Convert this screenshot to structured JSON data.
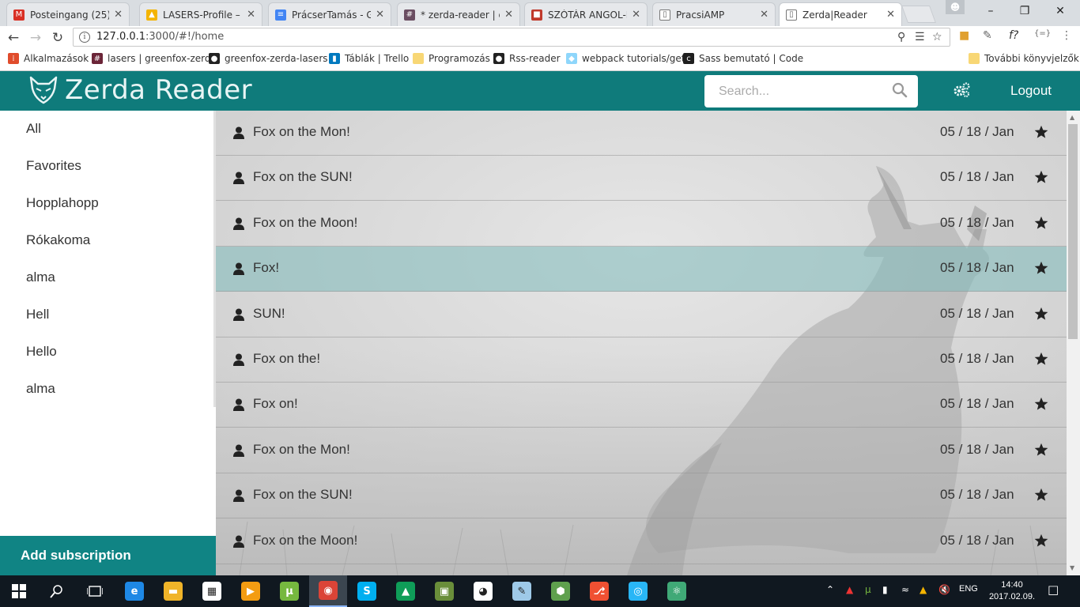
{
  "browser": {
    "tabs": [
      {
        "title": "Posteingang (25) -",
        "icon": "gmail-icon",
        "color": "#d93025",
        "glyph": "M"
      },
      {
        "title": "LASERS-Profile – G",
        "icon": "google-drive-icon",
        "color": "#f4b400",
        "glyph": "▲"
      },
      {
        "title": "PrácserTamás - Go",
        "icon": "google-docs-icon",
        "color": "#4285f4",
        "glyph": "≡"
      },
      {
        "title": "* zerda-reader | gr",
        "icon": "slack-hash-icon",
        "color": "#6b4e62",
        "glyph": "#"
      },
      {
        "title": "SZÓTÁR ANGOL-M",
        "icon": "flag-icon",
        "color": "#c0392b",
        "glyph": "■"
      },
      {
        "title": "PracsiAMP",
        "icon": "page-icon",
        "color": "#ffffff",
        "glyph": "▯"
      },
      {
        "title": "Zerda|Reader",
        "icon": "page-icon",
        "color": "#ffffff",
        "glyph": "▯"
      }
    ],
    "url_host": "127.0.0.1",
    "url_path": ":3000/#!/home",
    "bookmarks": [
      {
        "label": "Alkalmazások",
        "icon": "apps-icon",
        "color": "#e04c2c",
        "glyph": "⁞"
      },
      {
        "label": "lasers | greenfox-zerd",
        "icon": "slack-icon",
        "color": "#6b2538",
        "glyph": "#"
      },
      {
        "label": "greenfox-zerda-lasers",
        "icon": "github-icon",
        "color": "#222222",
        "glyph": "●"
      },
      {
        "label": "Táblák | Trello",
        "icon": "trello-icon",
        "color": "#0079bf",
        "glyph": "▮"
      },
      {
        "label": "Programozás",
        "icon": "folder-icon",
        "color": "#f8d775",
        "glyph": ""
      },
      {
        "label": "Rss-reader",
        "icon": "github-icon",
        "color": "#222222",
        "glyph": "●"
      },
      {
        "label": "webpack tutorials/get",
        "icon": "webpack-icon",
        "color": "#8ed6fb",
        "glyph": "◆"
      },
      {
        "label": "Sass bemutató | Code",
        "icon": "codecademy-icon",
        "color": "#1f1f1f",
        "glyph": "c"
      }
    ],
    "other_bookmarks": "További könyvjelzők"
  },
  "header": {
    "logo_text": "Zerda Reader",
    "search_placeholder": "Search...",
    "logout_label": "Logout"
  },
  "sidebar": {
    "items": [
      "All",
      "Favorites",
      "Hopplahopp",
      "Rókakoma",
      "alma",
      "Hell",
      "Hello",
      "alma"
    ],
    "add_subscription": "Add subscription"
  },
  "feed": {
    "items": [
      {
        "title": "Fox on the Mon!",
        "date": "05 / 18 / Jan",
        "selected": false
      },
      {
        "title": "Fox on the SUN!",
        "date": "05 / 18 / Jan",
        "selected": false
      },
      {
        "title": "Fox on the Moon!",
        "date": "05 / 18 / Jan",
        "selected": false
      },
      {
        "title": "Fox!",
        "date": "05 / 18 / Jan",
        "selected": true
      },
      {
        "title": "SUN!",
        "date": "05 / 18 / Jan",
        "selected": false
      },
      {
        "title": "Fox on the!",
        "date": "05 / 18 / Jan",
        "selected": false
      },
      {
        "title": "Fox on!",
        "date": "05 / 18 / Jan",
        "selected": false
      },
      {
        "title": "Fox on the Mon!",
        "date": "05 / 18 / Jan",
        "selected": false
      },
      {
        "title": "Fox on the SUN!",
        "date": "05 / 18 / Jan",
        "selected": false
      },
      {
        "title": "Fox on the Moon!",
        "date": "05 / 18 / Jan",
        "selected": false
      }
    ]
  },
  "colors": {
    "brand": "#0f7b7b",
    "add_subscription_bg": "#108484",
    "selected_row": "#a9c9c9"
  },
  "taskbar": {
    "apps": [
      {
        "name": "edge-icon",
        "color": "#1e88e5",
        "glyph": "e"
      },
      {
        "name": "file-explorer-icon",
        "color": "#f0b429",
        "glyph": "▬"
      },
      {
        "name": "store-icon",
        "color": "#ffffff",
        "glyph": "▦"
      },
      {
        "name": "media-player-icon",
        "color": "#f39c12",
        "glyph": "▶"
      },
      {
        "name": "utorrent-icon",
        "color": "#76b83f",
        "glyph": "µ"
      },
      {
        "name": "chrome-icon",
        "color": "#db4437",
        "glyph": "◉"
      },
      {
        "name": "skype-icon",
        "color": "#00aff0",
        "glyph": "S"
      },
      {
        "name": "google-drive-icon",
        "color": "#0f9d58",
        "glyph": "▲"
      },
      {
        "name": "minecraft-icon",
        "color": "#6a8e3a",
        "glyph": "▣"
      },
      {
        "name": "panda-icon",
        "color": "#ffffff",
        "glyph": "◕"
      },
      {
        "name": "paint-icon",
        "color": "#9ec9e8",
        "glyph": "✎"
      },
      {
        "name": "nodejs-icon",
        "color": "#5fa04e",
        "glyph": "⬢"
      },
      {
        "name": "git-icon",
        "color": "#f05032",
        "glyph": "⎇"
      },
      {
        "name": "browser-icon",
        "color": "#29b6f6",
        "glyph": "◎"
      },
      {
        "name": "atom-icon",
        "color": "#40a977",
        "glyph": "⚛"
      }
    ],
    "language": "ENG",
    "time": "14:40",
    "date": "2017.02.09."
  }
}
